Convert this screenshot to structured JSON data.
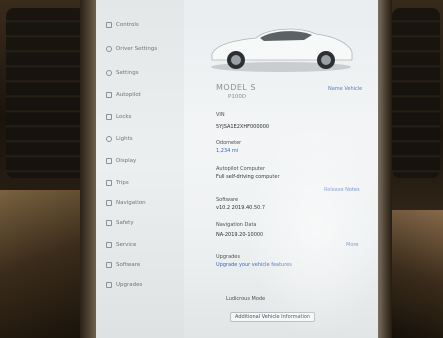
{
  "sidebar": {
    "items": [
      {
        "label": "Controls",
        "icon": "toggle-icon"
      },
      {
        "label": "Driver Settings",
        "icon": "steering-icon"
      },
      {
        "label": "Settings",
        "icon": "gear-icon"
      },
      {
        "label": "Autopilot",
        "icon": "autopilot-icon"
      },
      {
        "label": "Locks",
        "icon": "lock-icon"
      },
      {
        "label": "Lights",
        "icon": "light-icon"
      },
      {
        "label": "Display",
        "icon": "display-icon"
      },
      {
        "label": "Trips",
        "icon": "trip-icon"
      },
      {
        "label": "Navigation",
        "icon": "navigation-icon"
      },
      {
        "label": "Safety",
        "icon": "shield-icon"
      },
      {
        "label": "Service",
        "icon": "wrench-icon"
      },
      {
        "label": "Software",
        "icon": "download-icon"
      },
      {
        "label": "Upgrades",
        "icon": "upgrade-icon"
      }
    ]
  },
  "vehicle": {
    "model": "MODEL S",
    "variant": "P100D",
    "name_link": "Name Vehicle",
    "vin_label": "VIN",
    "vin_value": "5YJSA1E2XHF000000",
    "odometer_label": "Odometer",
    "odometer_value": "1,234 mi",
    "autopilot_label": "Autopilot Computer",
    "autopilot_value": "Full self-driving computer",
    "release_link": "Release Notes",
    "software_label": "Software",
    "software_value": "v10.2 2019.40.50.7",
    "nav_label": "Navigation Data",
    "nav_value": "NA-2019.20-10000",
    "more_link": "More",
    "upgrades_label": "Upgrades",
    "upgrades_value": "Upgrade your vehicle features",
    "footer_text": "Ludicrous Mode",
    "footer_button": "Additional Vehicle Information"
  },
  "colors": {
    "screen_bg": "#eef1f2",
    "link_blue": "#3766c8",
    "text_grey": "#6d7478"
  }
}
